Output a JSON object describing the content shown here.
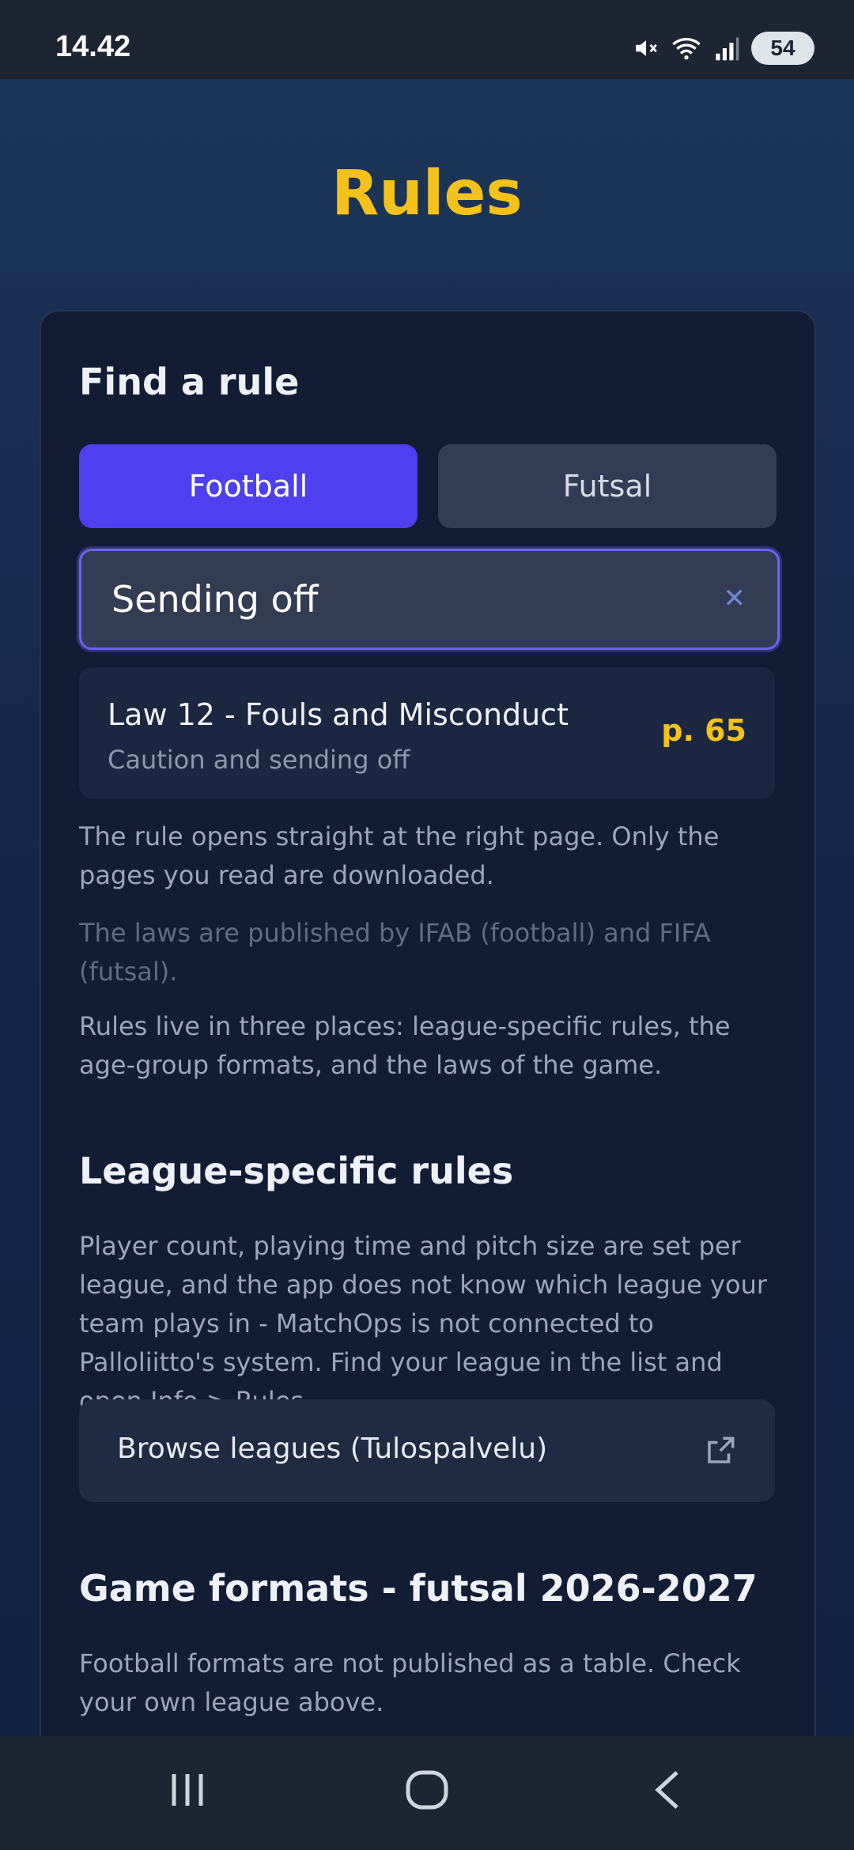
{
  "status": {
    "time": "14.42",
    "battery": "54"
  },
  "header": {
    "title": "Rules"
  },
  "find": {
    "title": "Find a rule",
    "tabs": [
      {
        "label": "Football",
        "active": true
      },
      {
        "label": "Futsal",
        "active": false
      }
    ],
    "search_value": "Sending off",
    "result": {
      "title": "Law 12 - Fouls and Misconduct",
      "subtitle": "Caution and sending off",
      "page": "p. 65"
    },
    "note1": "The rule opens straight at the right page. Only the pages you read are downloaded.",
    "note2": "The laws are published by IFAB (football) and FIFA (futsal)."
  },
  "intro": "Rules live in three places: league-specific rules, the age-group formats, and the laws of the game.",
  "league": {
    "title": "League-specific rules",
    "body": "Player count, playing time and pitch size are set per league, and the app does not know which league your team plays in - MatchOps is not connected to Palloliitto's system. Find your league in the list and open Info > Rules.",
    "button": "Browse leagues (Tulospalvelu)"
  },
  "formats": {
    "title": "Game formats - futsal 2026-2027",
    "body": "Football formats are not published as a table. Check your own league above."
  },
  "colors": {
    "accent": "#f4c21a",
    "primary": "#4e3ff0"
  }
}
